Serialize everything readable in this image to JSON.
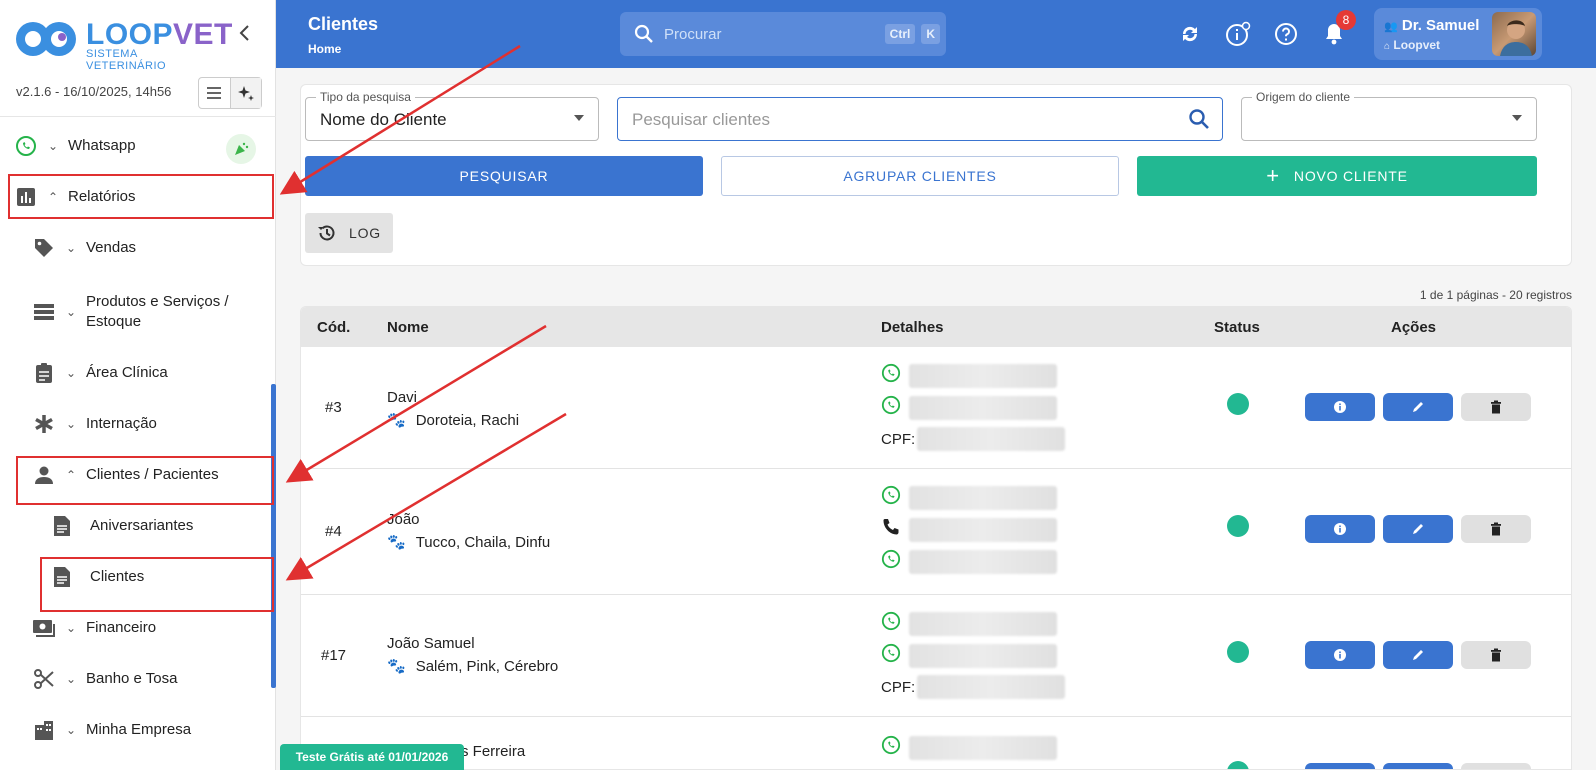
{
  "app": {
    "logo_main": "LOOP",
    "logo_accent": "VET",
    "logo_sub": "SISTEMA VETERINÁRIO",
    "version": "v2.1.6 - 16/10/2025, 14h56"
  },
  "sidebar": {
    "items": [
      {
        "label": "Whatsapp",
        "icon": "whatsapp-icon"
      },
      {
        "label": "Relatórios",
        "icon": "bar-chart-icon"
      },
      {
        "label": "Vendas",
        "icon": "tag-icon"
      },
      {
        "label": "Produtos e Serviços /",
        "label2": "Estoque",
        "icon": "list-icon"
      },
      {
        "label": "Área Clínica",
        "icon": "clipboard-icon"
      },
      {
        "label": "Internação",
        "icon": "asterisk-icon"
      },
      {
        "label": "Clientes / Pacientes",
        "icon": "person-icon"
      },
      {
        "label": "Aniversariantes",
        "icon": "document-icon"
      },
      {
        "label": "Clientes",
        "icon": "document-icon"
      },
      {
        "label": "Financeiro",
        "icon": "money-icon"
      },
      {
        "label": "Banho e Tosa",
        "icon": "scissors-icon"
      },
      {
        "label": "Minha Empresa",
        "icon": "building-icon"
      }
    ]
  },
  "header": {
    "title": "Clientes",
    "breadcrumb": "Home",
    "search_placeholder": "Procurar",
    "kbd1": "Ctrl",
    "kbd2": "K",
    "notifications": "8",
    "user_name": "Dr. Samuel",
    "user_org": "Loopvet"
  },
  "filters": {
    "tipo_label": "Tipo da pesquisa",
    "tipo_value": "Nome do Cliente",
    "search_placeholder": "Pesquisar clientes",
    "origem_label": "Origem do cliente",
    "btn_pesquisar": "PESQUISAR",
    "btn_agrupar": "AGRUPAR CLIENTES",
    "btn_novo": "NOVO CLIENTE",
    "btn_log": "LOG"
  },
  "pagination": "1 de 1 páginas - 20 registros",
  "table": {
    "headers": [
      "Cód.",
      "Nome",
      "Detalhes",
      "Status",
      "Ações"
    ],
    "rows": [
      {
        "code": "#3",
        "name": "Davi",
        "pets": "Doroteia,  Rachi",
        "cpf": "CPF:"
      },
      {
        "code": "#4",
        "name": "João",
        "pets": "Tucco,  Chaila,  Dinfu",
        "cpf": ""
      },
      {
        "code": "#17",
        "name": "João Samuel",
        "pets": "Salém,  Pink,  Cérebro",
        "cpf": "CPF:"
      },
      {
        "code": "",
        "name": "s Ferreira",
        "pets": "",
        "cpf": ""
      }
    ]
  },
  "trial": "Teste Grátis até 01/01/2026",
  "colors": {
    "primary": "#3a74d0",
    "green": "#22b892",
    "annotation": "#e03030"
  }
}
